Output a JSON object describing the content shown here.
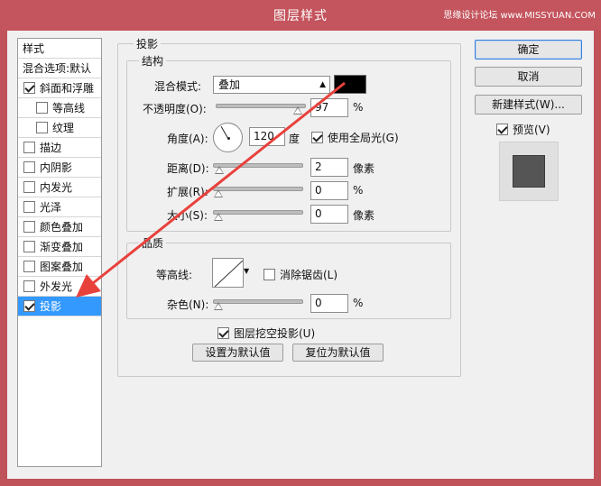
{
  "window": {
    "title": "图层样式",
    "watermark": "思缘设计论坛 www.MISSYUAN.COM"
  },
  "colors": {
    "titlebar": "#c4545d",
    "selection": "#3399ff",
    "arrow": "#e8413c",
    "shadow_color": "#000000"
  },
  "left_panel": {
    "header": "样式",
    "blend_options": "混合选项:默认",
    "items": [
      {
        "label": "斜面和浮雕",
        "checked": true
      },
      {
        "label": "等高线",
        "checked": false
      },
      {
        "label": "纹理",
        "checked": false
      },
      {
        "label": "描边",
        "checked": false
      },
      {
        "label": "内阴影",
        "checked": false
      },
      {
        "label": "内发光",
        "checked": false
      },
      {
        "label": "光泽",
        "checked": false
      },
      {
        "label": "颜色叠加",
        "checked": false
      },
      {
        "label": "渐变叠加",
        "checked": false
      },
      {
        "label": "图案叠加",
        "checked": false
      },
      {
        "label": "外发光",
        "checked": false
      },
      {
        "label": "投影",
        "checked": true,
        "selected": true
      }
    ]
  },
  "main": {
    "section_title": "投影",
    "structure": {
      "title": "结构",
      "blend_mode_label": "混合模式:",
      "blend_mode_value": "叠加",
      "opacity_label": "不透明度(O):",
      "opacity_value": "97",
      "opacity_unit": "%",
      "opacity_fraction": 0.97,
      "angle_label": "角度(A):",
      "angle_value": "120",
      "angle_unit": "度",
      "use_global_light_label": "使用全局光(G)",
      "use_global_light": true,
      "distance_label": "距离(D):",
      "distance_value": "2",
      "distance_unit": "像素",
      "distance_fraction": 0.01,
      "spread_label": "扩展(R):",
      "spread_value": "0",
      "spread_unit": "%",
      "spread_fraction": 0.0,
      "size_label": "大小(S):",
      "size_value": "0",
      "size_unit": "像素",
      "size_fraction": 0.0
    },
    "quality": {
      "title": "品质",
      "contour_label": "等高线:",
      "antialias_label": "消除锯齿(L)",
      "antialias": false,
      "noise_label": "杂色(N):",
      "noise_value": "0",
      "noise_unit": "%",
      "noise_fraction": 0.0
    },
    "knockout_label": "图层挖空投影(U)",
    "knockout": true,
    "make_default_label": "设置为默认值",
    "reset_default_label": "复位为默认值"
  },
  "right_panel": {
    "ok_label": "确定",
    "cancel_label": "取消",
    "new_style_label": "新建样式(W)...",
    "preview_label": "预览(V)",
    "preview_checked": true
  }
}
